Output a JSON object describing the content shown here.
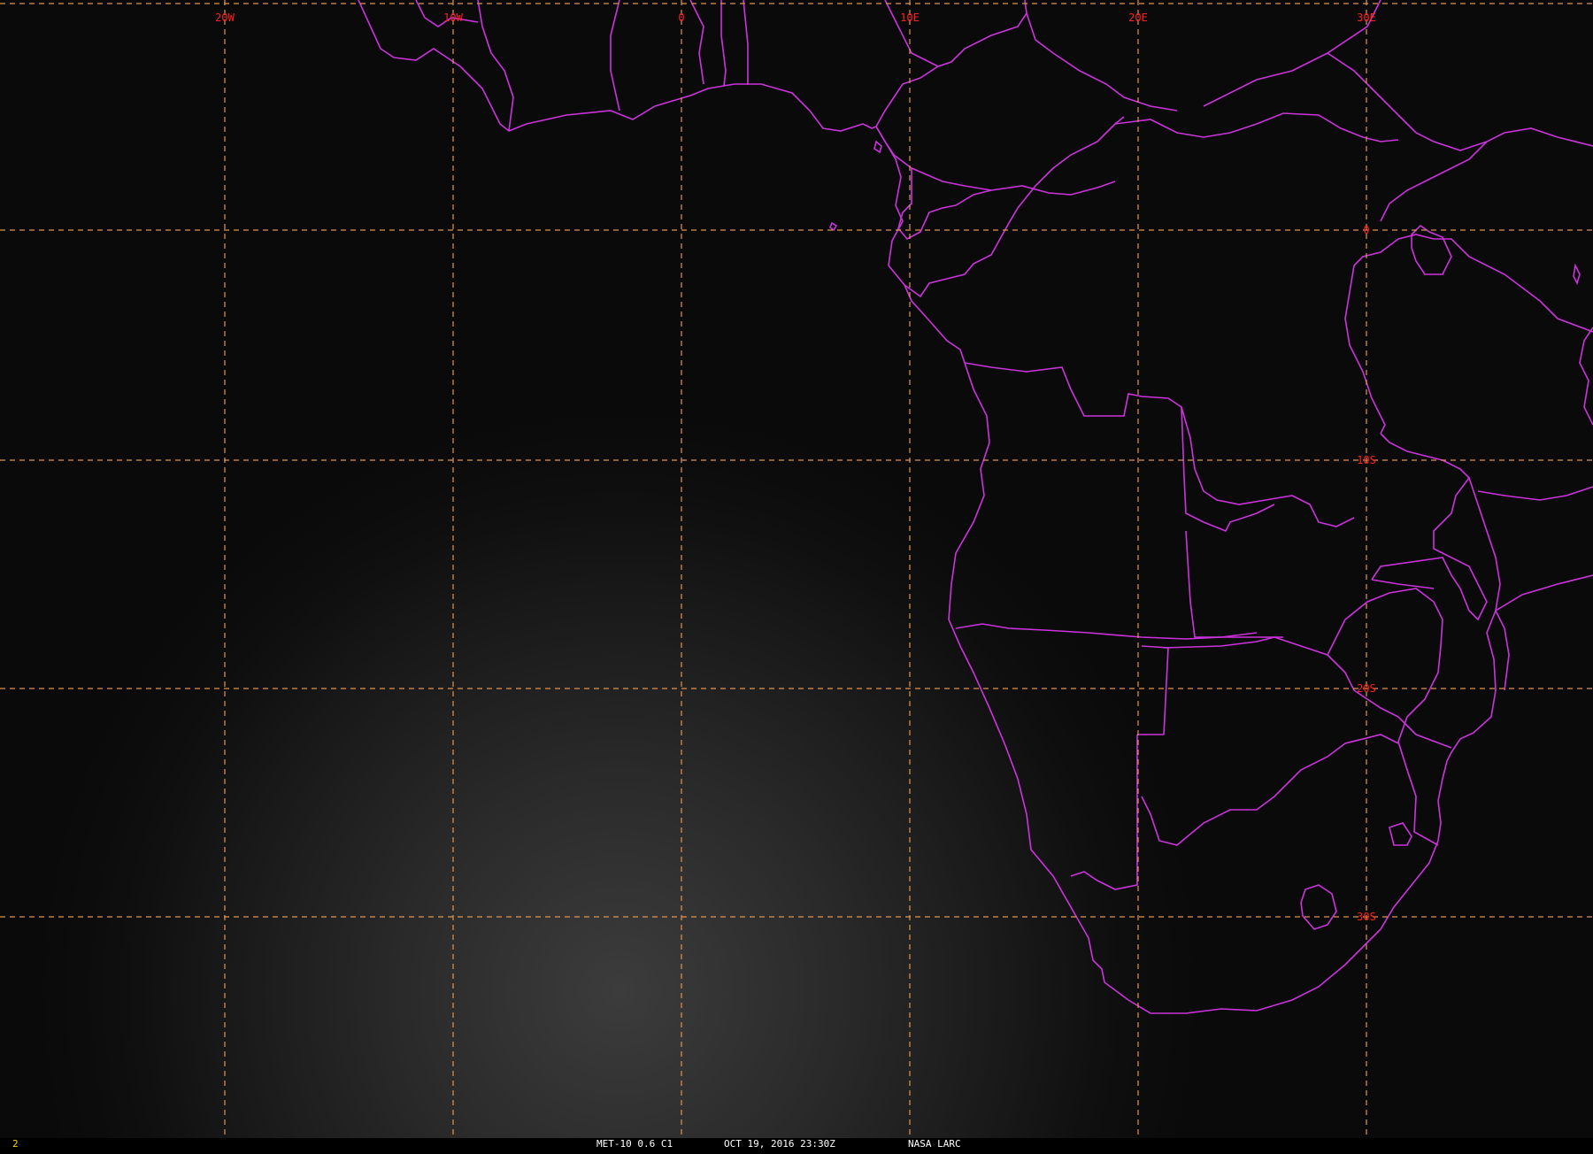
{
  "map": {
    "colors": {
      "background": "#0a0a0a",
      "grid": "#e0954f",
      "grid_label": "#ff2020",
      "coastline": "#cc33dd",
      "status_text": "#ffffff",
      "frame_number": "#ffd400"
    },
    "longitude_labels": [
      "20W",
      "10W",
      "0",
      "10E",
      "20E",
      "30E"
    ],
    "latitude_labels": [
      "0",
      "10S",
      "20S",
      "30S"
    ]
  },
  "status_bar": {
    "frame_number": "2",
    "product": "MET-10 0.6 C1",
    "timestamp": "OCT 19, 2016 23:30Z",
    "source": "NASA LARC"
  }
}
